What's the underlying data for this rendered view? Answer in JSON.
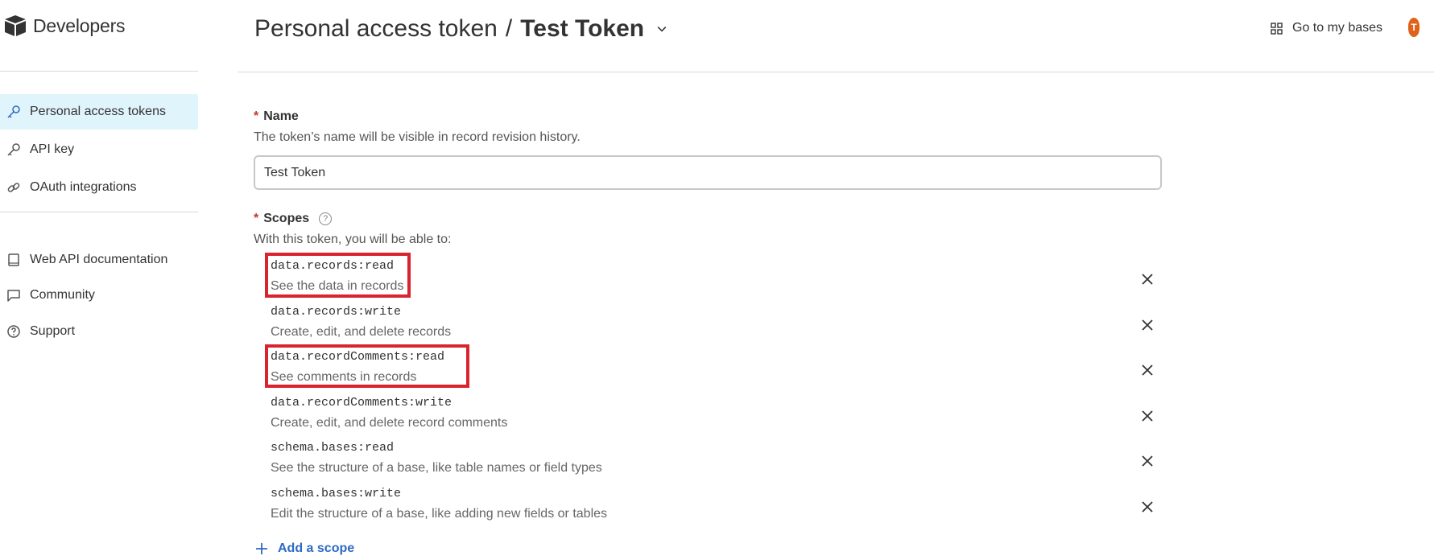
{
  "brand": {
    "name": "Developers"
  },
  "sidebar": {
    "primary": [
      {
        "label": "Personal access tokens",
        "icon": "key-icon",
        "active": true
      },
      {
        "label": "API key",
        "icon": "key-icon",
        "active": false
      },
      {
        "label": "OAuth integrations",
        "icon": "link-icon",
        "active": false
      }
    ],
    "secondary": [
      {
        "label": "Web API documentation",
        "icon": "book-icon"
      },
      {
        "label": "Community",
        "icon": "chat-icon"
      },
      {
        "label": "Support",
        "icon": "question-icon"
      }
    ]
  },
  "header": {
    "breadcrumb": "Personal access token",
    "separator": "/",
    "token_name": "Test Token",
    "goto_label": "Go to my bases",
    "avatar_initial": "T"
  },
  "form": {
    "required_mark": "*",
    "name_label": "Name",
    "name_help": "The token’s name will be visible in record revision history.",
    "name_value": "Test Token",
    "scopes_label": "Scopes",
    "scopes_help_icon": "?",
    "scopes_help": "With this token, you will be able to:",
    "scopes": [
      {
        "code": "data.records:read",
        "desc": "See the data in records",
        "highlighted": true
      },
      {
        "code": "data.records:write",
        "desc": "Create, edit, and delete records",
        "highlighted": false
      },
      {
        "code": "data.recordComments:read",
        "desc": "See comments in records",
        "highlighted": true
      },
      {
        "code": "data.recordComments:write",
        "desc": "Create, edit, and delete record comments",
        "highlighted": false
      },
      {
        "code": "schema.bases:read",
        "desc": "See the structure of a base, like table names or field types",
        "highlighted": false
      },
      {
        "code": "schema.bases:write",
        "desc": "Edit the structure of a base, like adding new fields or tables",
        "highlighted": false
      }
    ],
    "add_scope_label": "Add a scope"
  },
  "colors": {
    "accent": "#2d6ac4",
    "active_bg": "#e0f4fb",
    "highlight": "#d9232e",
    "required": "#c0392b"
  }
}
